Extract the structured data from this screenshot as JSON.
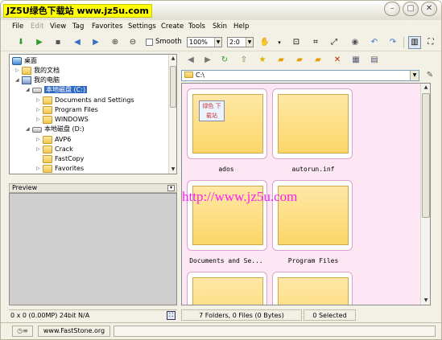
{
  "title": {
    "watermark": "JZ5U绿色下载站 www.jz5u.com",
    "buttons": {
      "minimize": "–",
      "restore": "▢",
      "close": "✕"
    }
  },
  "menu": {
    "items": [
      "File",
      "Edit",
      "View",
      "Tag",
      "Favorites",
      "Settings",
      "Create",
      "Tools",
      "Skin",
      "Help"
    ],
    "disabled": [
      "Edit"
    ]
  },
  "toolbar": {
    "smooth_label": "Smooth",
    "zoom_value": "100%",
    "ratio_value": "2:0"
  },
  "tree": {
    "items": [
      {
        "label": "桌面",
        "icon": "desktop-icon",
        "level": 0
      },
      {
        "label": "我的文档",
        "icon": "folder-icon",
        "level": 1
      },
      {
        "label": "我的电脑",
        "icon": "computer-icon",
        "level": 1
      },
      {
        "label": "本地磁盘 (C:)",
        "icon": "drive-icon",
        "level": 2,
        "selected": true
      },
      {
        "label": "Documents and Settings",
        "icon": "folder-icon",
        "level": 3
      },
      {
        "label": "Program Files",
        "icon": "folder-icon",
        "level": 3
      },
      {
        "label": "WINDOWS",
        "icon": "folder-icon",
        "level": 3
      },
      {
        "label": "本地磁盘 (D:)",
        "icon": "drive-icon",
        "level": 2
      },
      {
        "label": "AVP6",
        "icon": "folder-icon",
        "level": 3
      },
      {
        "label": "Crack",
        "icon": "folder-icon",
        "level": 3
      },
      {
        "label": "FastCopy",
        "icon": "folder-icon",
        "level": 3
      },
      {
        "label": "Favorites",
        "icon": "folder-icon",
        "level": 3
      }
    ]
  },
  "preview": {
    "label": "Preview"
  },
  "status_left": {
    "info": "0 x 0 (0.00MP)  24bit N/A"
  },
  "browser": {
    "path": "C:\\",
    "files": [
      {
        "name": "ados"
      },
      {
        "name": "autorun.inf"
      },
      {
        "name": "Documents and Se..."
      },
      {
        "name": "Program Files"
      },
      {
        "name": ""
      },
      {
        "name": ""
      }
    ],
    "thumb_logo_text": "绿色 下载站",
    "url_watermark": "http://www.jz5u.com"
  },
  "status_right": {
    "summary": "7 Folders, 0 Files (0 Bytes)",
    "selected": "0 Selected"
  },
  "footer": {
    "site": "www.FastStone.org"
  },
  "colors": {
    "thumb_bg": "#fde7f5",
    "folder": "#fbd668",
    "selection": "#316ac5",
    "watermark_text": "#ff1cf4"
  }
}
